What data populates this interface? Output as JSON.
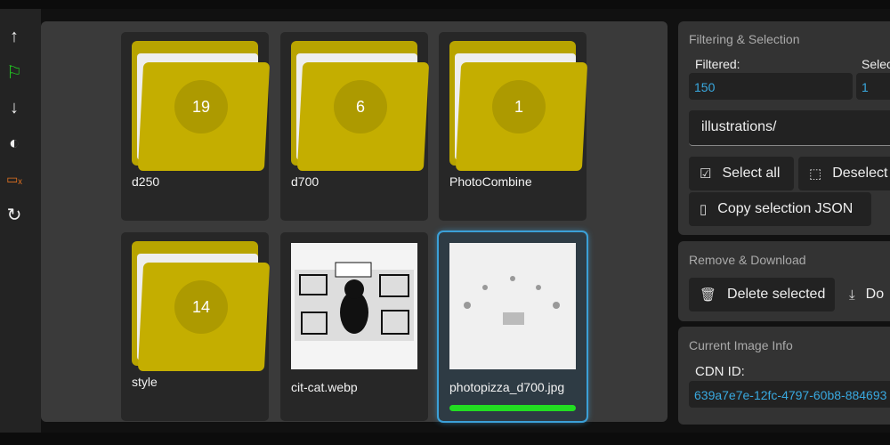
{
  "toolbar": {
    "icons": [
      "arrow-up-icon",
      "flag-icon",
      "arrow-down-icon",
      "contrast-icon",
      "clear-selection-icon",
      "refresh-icon"
    ],
    "flag_color": "#22cc22",
    "clear_color": "#e07020"
  },
  "grid": {
    "items": [
      {
        "type": "folder",
        "name": "d250",
        "count": "19"
      },
      {
        "type": "folder",
        "name": "d700",
        "count": "6"
      },
      {
        "type": "folder",
        "name": "PhotoCombine",
        "count": "1"
      },
      {
        "type": "folder",
        "name": "style",
        "count": "14"
      },
      {
        "type": "image",
        "name": "cit-cat.webp"
      },
      {
        "type": "image",
        "name": "photopizza_d700.jpg",
        "selected": true,
        "progress": 100
      }
    ]
  },
  "filtering": {
    "title": "Filtering & Selection",
    "filtered_label": "Filtered:",
    "filtered_value": "150",
    "selected_label": "Selec",
    "selected_value": "1",
    "path_value": "illustrations/",
    "select_all": "Select all",
    "deselect": "Deselect",
    "copy_json": "Copy selection JSON"
  },
  "remove": {
    "title": "Remove & Download",
    "delete": "Delete selected",
    "download": "Do"
  },
  "info": {
    "title": "Current Image Info",
    "cdn_label": "CDN ID:",
    "cdn_value": "639a7e7e-12fc-4797-60b8-884693"
  }
}
